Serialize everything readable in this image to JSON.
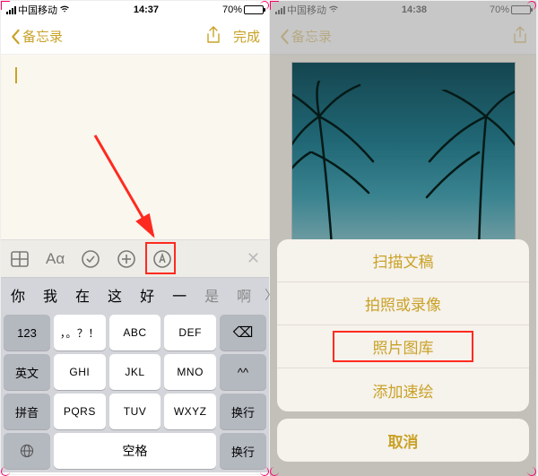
{
  "left": {
    "status": {
      "carrier": "中国移动",
      "time": "14:37",
      "battery": "70%"
    },
    "nav": {
      "back": "备忘录",
      "done": "完成"
    },
    "formatbar": {
      "aa": "Aα"
    },
    "candidates": [
      "你",
      "我",
      "在",
      "这",
      "好",
      "一",
      "是",
      "啊"
    ],
    "keys": {
      "r1": [
        "123",
        "，。？！",
        "ABC",
        "DEF"
      ],
      "bksp": "⌫",
      "r2": [
        "英文",
        "GHI",
        "JKL",
        "MNO"
      ],
      "caret": "^^",
      "r3": [
        "拼音",
        "PQRS",
        "TUV",
        "WXYZ"
      ],
      "enter": "换行",
      "space": "空格"
    }
  },
  "right": {
    "status": {
      "carrier": "中国移动",
      "time": "14:38",
      "battery": "70%"
    },
    "nav": {
      "back": "备忘录"
    },
    "sheet": {
      "scan": "扫描文稿",
      "camera": "拍照或录像",
      "library": "照片图库",
      "sketch": "添加速绘",
      "cancel": "取消"
    }
  }
}
